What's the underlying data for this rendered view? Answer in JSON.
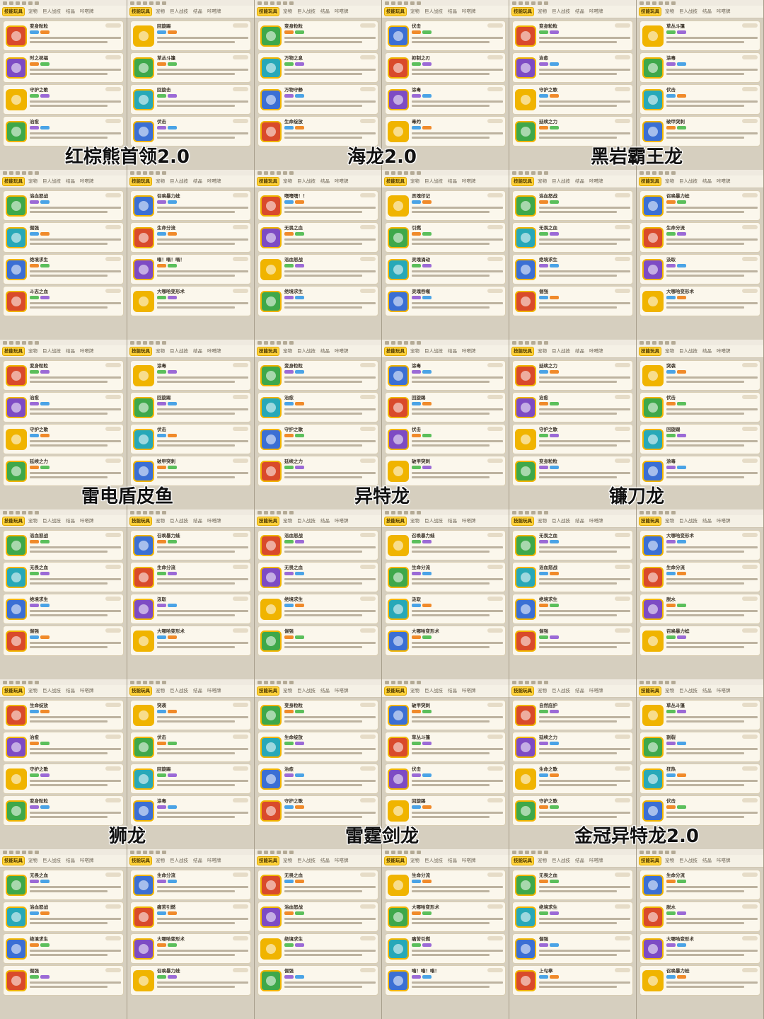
{
  "tab_bar": {
    "tabs": [
      "技能玩具",
      "宠物",
      "巨人战技",
      "结晶",
      "咔嗒牌"
    ],
    "active_tab": "技能玩具"
  },
  "colors": {
    "active_tab": "#ffd23a",
    "card_background": "#fbf7ec",
    "icon_gold": "#f0b400",
    "icon_red": "#d94a2b",
    "icon_purple": "#7d4bc4",
    "icon_green": "#3ea84a",
    "icon_cyan": "#27a8b8",
    "icon_blue": "#3b6fd4"
  },
  "tiles": [
    {
      "title": "红棕熊首领2.0",
      "left": [
        "变身粒粒",
        "时之祝福",
        "守护之歌",
        "治愈"
      ],
      "right": [
        "回旋踢",
        "草丛斗篷",
        "回旋击",
        "伏击"
      ]
    },
    {
      "title": "海龙2.0",
      "left": [
        "变身粒粒",
        "万物之息",
        "万物守静",
        "生命绽放"
      ],
      "right": [
        "伏击",
        "抑制之刃",
        "涂毒",
        "毒灼"
      ]
    },
    {
      "title": "黑岩霸王龙",
      "left": [
        "变身粒粒",
        "治愈",
        "守护之歌",
        "延续之力"
      ],
      "right": [
        "草丛斗篷",
        "涂毒",
        "伏击",
        "破甲突刺"
      ]
    },
    {
      "title": "",
      "left": [
        "浴血怒战",
        "倔强",
        "绝境求生",
        "斗志之血"
      ],
      "right": [
        "召唤暴力蛙",
        "生命分流",
        "嗡！嗡！嗡！",
        "大哪哈变形术"
      ]
    },
    {
      "title": "",
      "left": [
        "嗜嗜嗜！！",
        "无畏之血",
        "浴血怒战",
        "绝境求生"
      ],
      "right": [
        "灵魂印记",
        "引燃",
        "灵魂涌动",
        "灵魂吞噬"
      ]
    },
    {
      "title": "",
      "left": [
        "浴血怒战",
        "无畏之血",
        "绝境求生",
        "倔强"
      ],
      "right": [
        "召唤暴力蛙",
        "生命分流",
        "汲取",
        "大哪哈变形术"
      ]
    },
    {
      "title": "雷电盾皮鱼",
      "left": [
        "变身粒粒",
        "治愈",
        "守护之歌",
        "延续之力"
      ],
      "right": [
        "涂毒",
        "回旋踢",
        "伏击",
        "破甲突刺"
      ]
    },
    {
      "title": "异特龙",
      "left": [
        "变身粒粒",
        "治愈",
        "守护之歌",
        "延续之力"
      ],
      "right": [
        "涂毒",
        "回旋踢",
        "伏击",
        "破甲突刺"
      ]
    },
    {
      "title": "镰刀龙",
      "left": [
        "延续之力",
        "治愈",
        "守护之歌",
        "变身粒粒"
      ],
      "right": [
        "突袭",
        "伏击",
        "回旋踢",
        "涂毒"
      ]
    },
    {
      "title": "",
      "left": [
        "浴血怒战",
        "无畏之血",
        "绝境求生",
        "倔强"
      ],
      "right": [
        "召唤暴力蛙",
        "生命分流",
        "汲取",
        "大哪哈变形术"
      ]
    },
    {
      "title": "",
      "left": [
        "浴血怒战",
        "无畏之血",
        "绝境求生",
        "倔强"
      ],
      "right": [
        "召唤暴力蛙",
        "生命分流",
        "汲取",
        "大哪哈变形术"
      ]
    },
    {
      "title": "",
      "left": [
        "无畏之血",
        "浴血怒战",
        "绝境求生",
        "倔强"
      ],
      "right": [
        "大哪哈变形术",
        "生命分流",
        "脱水",
        "召唤暴力蛙"
      ]
    },
    {
      "title": "狮龙",
      "left": [
        "生命绽放",
        "治愈",
        "守护之歌",
        "变身粒粒"
      ],
      "right": [
        "突袭",
        "伏击",
        "回旋踢",
        "涂毒"
      ]
    },
    {
      "title": "雷霆剑龙",
      "left": [
        "变身粒粒",
        "生命绽放",
        "治愈",
        "守护之歌"
      ],
      "right": [
        "破甲突刺",
        "草丛斗篷",
        "伏击",
        "回旋踢"
      ]
    },
    {
      "title": "金冠异特龙2.0",
      "left": [
        "自然庇护",
        "延续之力",
        "生命之歌",
        "守护之歌"
      ],
      "right": [
        "草丛斗篷",
        "割裂",
        "狂热",
        "伏击"
      ]
    },
    {
      "title": "",
      "left": [
        "无畏之血",
        "浴血怒战",
        "绝境求生",
        "倔强"
      ],
      "right": [
        "生命分流",
        "痛苦引燃",
        "大哪哈变形术",
        "召唤暴力蛙"
      ]
    },
    {
      "title": "",
      "left": [
        "无畏之血",
        "浴血怒战",
        "绝境求生",
        "倔强"
      ],
      "right": [
        "生命分流",
        "大哪哈变形术",
        "痛苦引燃",
        "嗡！嗡！嗡！"
      ]
    },
    {
      "title": "",
      "left": [
        "无畏之血",
        "绝境求生",
        "倔强",
        "上勾拳"
      ],
      "right": [
        "生命分流",
        "脱水",
        "大哪哈变形术",
        "召唤暴力蛙"
      ]
    }
  ]
}
